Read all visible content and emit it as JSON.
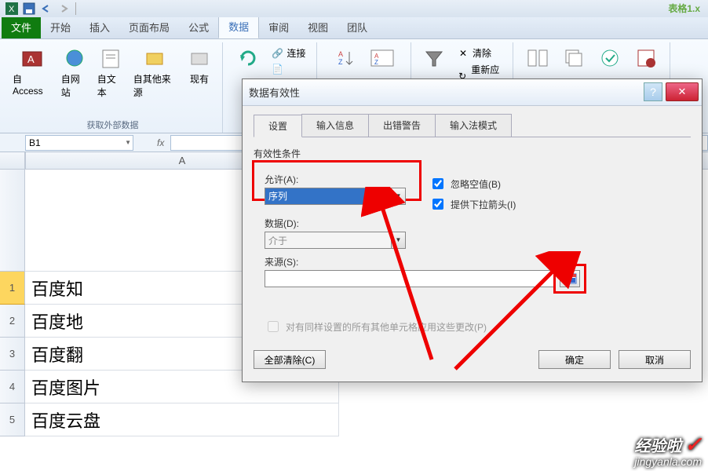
{
  "qat": {
    "title": "表格1.x"
  },
  "tabs": {
    "file": "文件",
    "items": [
      "开始",
      "插入",
      "页面布局",
      "公式",
      "数据",
      "审阅",
      "视图",
      "团队"
    ],
    "active_index": 4
  },
  "ribbon": {
    "ext": {
      "access": "自 Access",
      "web": "自网站",
      "text": "自文本",
      "other": "自其他来源",
      "existing": "现有",
      "group_label": "获取外部数据"
    },
    "conn": {
      "connections": "连接"
    },
    "sort": {},
    "filter": {
      "clear": "清除",
      "reapply": "重新应用"
    }
  },
  "namebox": {
    "ref": "B1"
  },
  "columns": {
    "a": "A"
  },
  "rows": [
    "1",
    "2",
    "3",
    "4",
    "5"
  ],
  "cells": {
    "a1": "百度知",
    "a2": "百度地",
    "a3": "百度翻",
    "a4": "百度图片",
    "a5": "百度云盘"
  },
  "dialog": {
    "title": "数据有效性",
    "tabs": [
      "设置",
      "输入信息",
      "出错警告",
      "输入法模式"
    ],
    "active_tab": 0,
    "section": "有效性条件",
    "allow_label": "允许(A):",
    "allow_value": "序列",
    "data_label": "数据(D):",
    "data_value": "介于",
    "ignore_blank": "忽略空值(B)",
    "dropdown": "提供下拉箭头(I)",
    "source_label": "来源(S):",
    "apply_all": "对有同样设置的所有其他单元格应用这些更改(P)",
    "clear_all": "全部清除(C)",
    "ok": "确定",
    "cancel": "取消"
  },
  "watermark": {
    "brand": "经验啦",
    "url": "jingyanla.com"
  }
}
